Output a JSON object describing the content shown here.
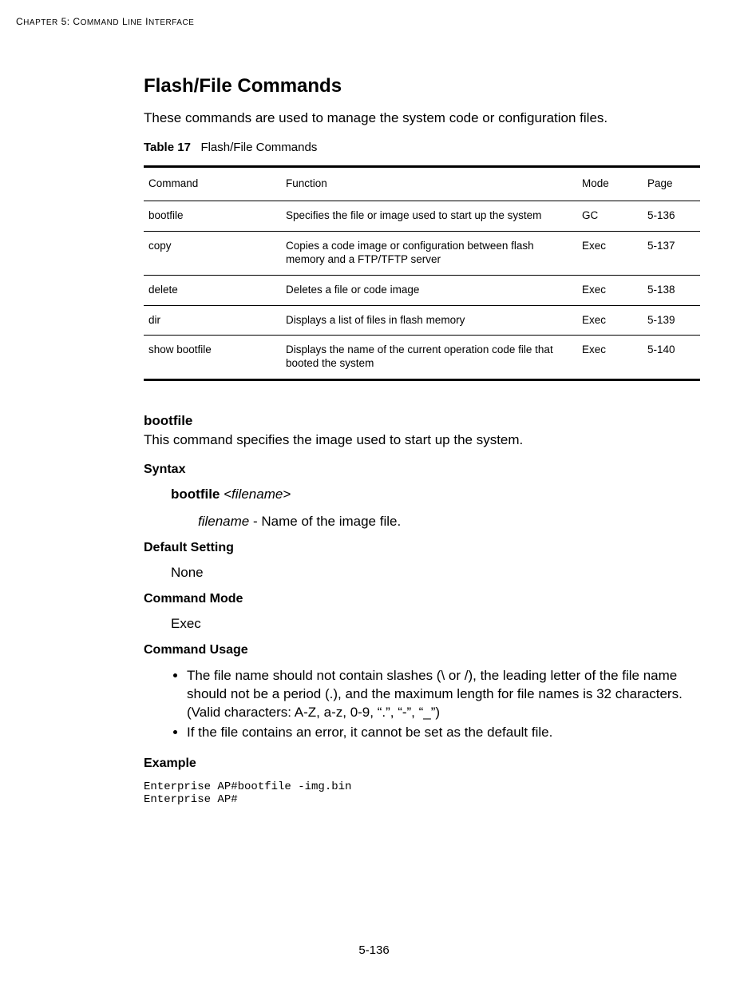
{
  "header": {
    "chapter": "Chapter 5: Command Line Interface"
  },
  "title": "Flash/File Commands",
  "intro": "These commands are used to manage the system code or configuration files.",
  "table_caption_label": "Table 17",
  "table_caption_text": "Flash/File Commands",
  "table": {
    "headers": {
      "command": "Command",
      "function": "Function",
      "mode": "Mode",
      "page": "Page"
    },
    "rows": [
      {
        "command": "bootfile",
        "function": "Specifies the file or image used to start up the system",
        "mode": "GC",
        "page": "5-136"
      },
      {
        "command": "copy",
        "function": "Copies a code image or configuration between flash memory and a FTP/TFTP server",
        "mode": "Exec",
        "page": "5-137"
      },
      {
        "command": "delete",
        "function": "Deletes a file or code image",
        "mode": "Exec",
        "page": "5-138"
      },
      {
        "command": "dir",
        "function": "Displays a list of files in flash memory",
        "mode": "Exec",
        "page": "5-139"
      },
      {
        "command": "show bootfile",
        "function": "Displays the name of the current operation code file that\nbooted the system",
        "mode": "Exec",
        "page": "5-140"
      }
    ]
  },
  "section": {
    "heading": "bootfile",
    "desc": "This command specifies the image used to start up the system.",
    "syntax_label": "Syntax",
    "syntax_cmd": "bootfile",
    "syntax_arg": "<filename>",
    "syntax_param_name": "filename",
    "syntax_param_desc": " - Name of the image file.",
    "default_label": "Default Setting",
    "default_value": "None",
    "mode_label": "Command Mode",
    "mode_value": "Exec",
    "usage_label": "Command Usage",
    "usage": [
      "The file name should not contain slashes (\\ or /), the leading letter of the file name should not be a period (.), and the maximum length for file names is 32 characters. (Valid characters: A-Z, a-z, 0-9, “.”, “-”, “_”)",
      "If the file contains an error, it cannot be set as the default file."
    ],
    "example_label": "Example",
    "example_code": "Enterprise AP#bootfile -img.bin\nEnterprise AP#"
  },
  "page_number": "5-136"
}
